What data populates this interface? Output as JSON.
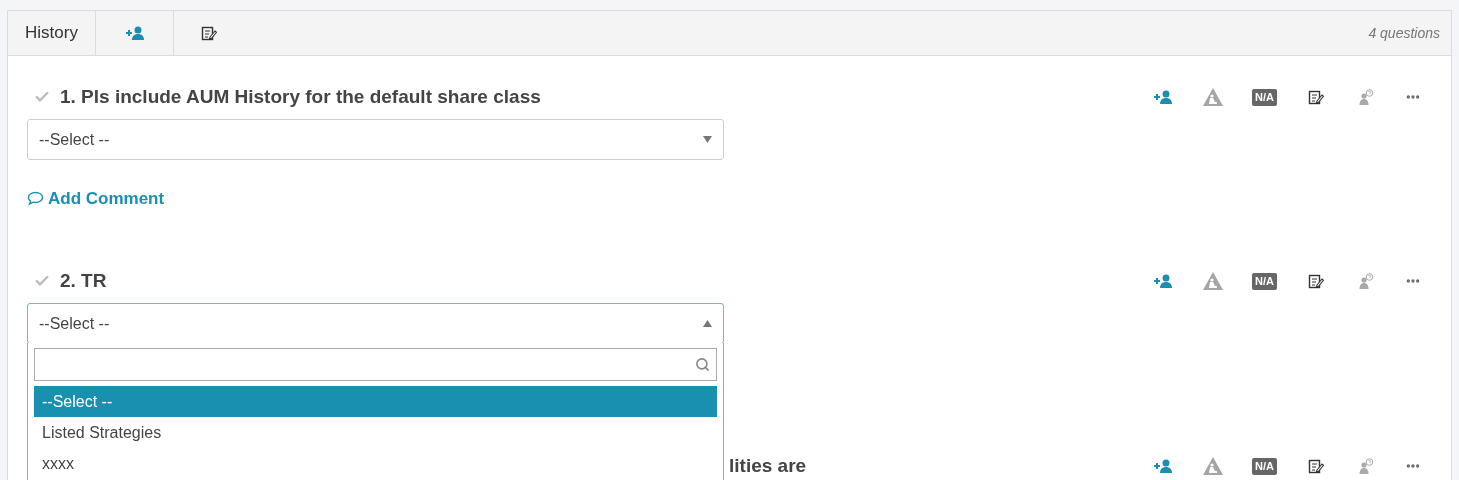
{
  "header": {
    "tabs": [
      {
        "kind": "text",
        "label": "History"
      },
      {
        "kind": "assign"
      },
      {
        "kind": "notes"
      }
    ],
    "count": "4 questions"
  },
  "questions": [
    {
      "title": "1. Pls include AUM History for the default share class",
      "na_label": "N/A",
      "select": {
        "value": "--Select --",
        "open": false
      },
      "add_comment": "Add Comment"
    },
    {
      "title": "2. TR",
      "na_label": "N/A",
      "select": {
        "value": "--Select --",
        "open": true,
        "options": [
          {
            "label": "--Select --",
            "selected": true
          },
          {
            "label": "Listed Strategies",
            "selected": false
          },
          {
            "label": "xxxx",
            "selected": false
          }
        ]
      }
    },
    {
      "title": "lities are",
      "na_label": "N/A"
    }
  ]
}
